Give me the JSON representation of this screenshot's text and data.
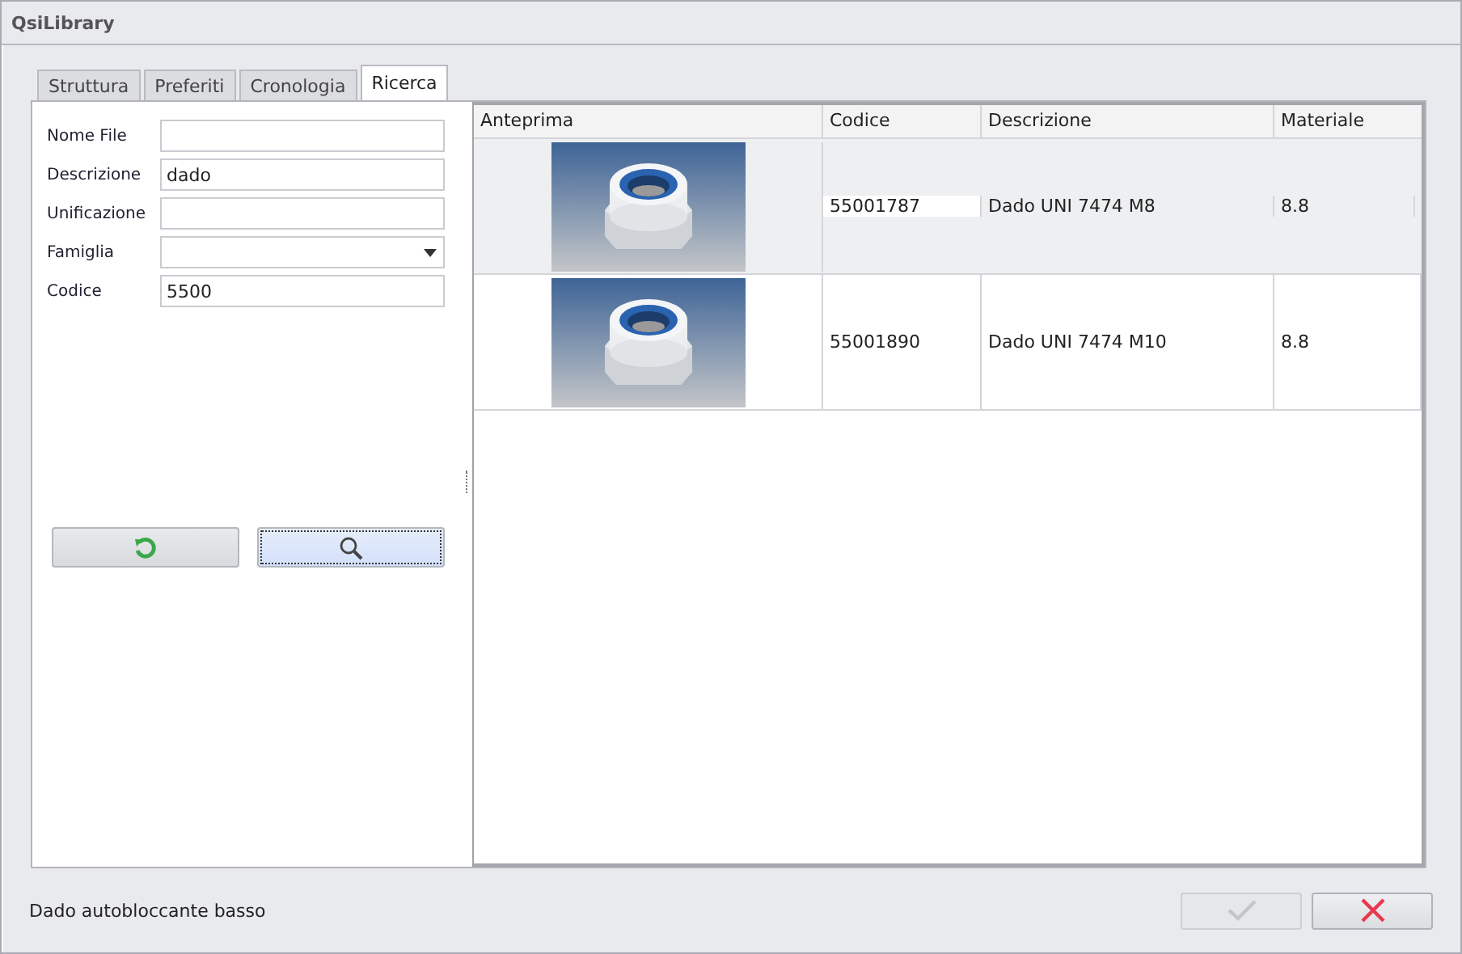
{
  "window": {
    "title": "QsiLibrary"
  },
  "tabs": [
    {
      "label": "Struttura",
      "selected": false
    },
    {
      "label": "Preferiti",
      "selected": false
    },
    {
      "label": "Cronologia",
      "selected": false
    },
    {
      "label": "Ricerca",
      "selected": true
    }
  ],
  "form": {
    "fields": [
      {
        "label": "Nome File",
        "kind": "text"
      },
      {
        "label": "Descrizione",
        "kind": "text",
        "value": "dado"
      },
      {
        "label": "Unificazione",
        "kind": "text"
      },
      {
        "label": "Famiglia",
        "kind": "select"
      },
      {
        "label": "Codice",
        "kind": "text",
        "value": "5500"
      }
    ],
    "buttons": [
      {
        "kind": "reset",
        "focused": false
      },
      {
        "kind": "search",
        "focused": true
      }
    ]
  },
  "table": {
    "columns": [
      "Anteprima",
      "Codice",
      "Descrizione",
      "Materiale"
    ],
    "rows": [
      {
        "codice": "55001787",
        "descrizione": "Dado UNI 7474 M8",
        "materiale": "8.8",
        "selected": true
      },
      {
        "codice": "55001890",
        "descrizione": "Dado UNI 7474 M10",
        "materiale": "8.8",
        "selected": false
      }
    ]
  },
  "status_bar": {
    "text": "Dado autobloccante basso"
  },
  "footer_buttons": [
    {
      "kind": "ok",
      "disabled": true
    },
    {
      "kind": "cancel",
      "disabled": false
    }
  ]
}
